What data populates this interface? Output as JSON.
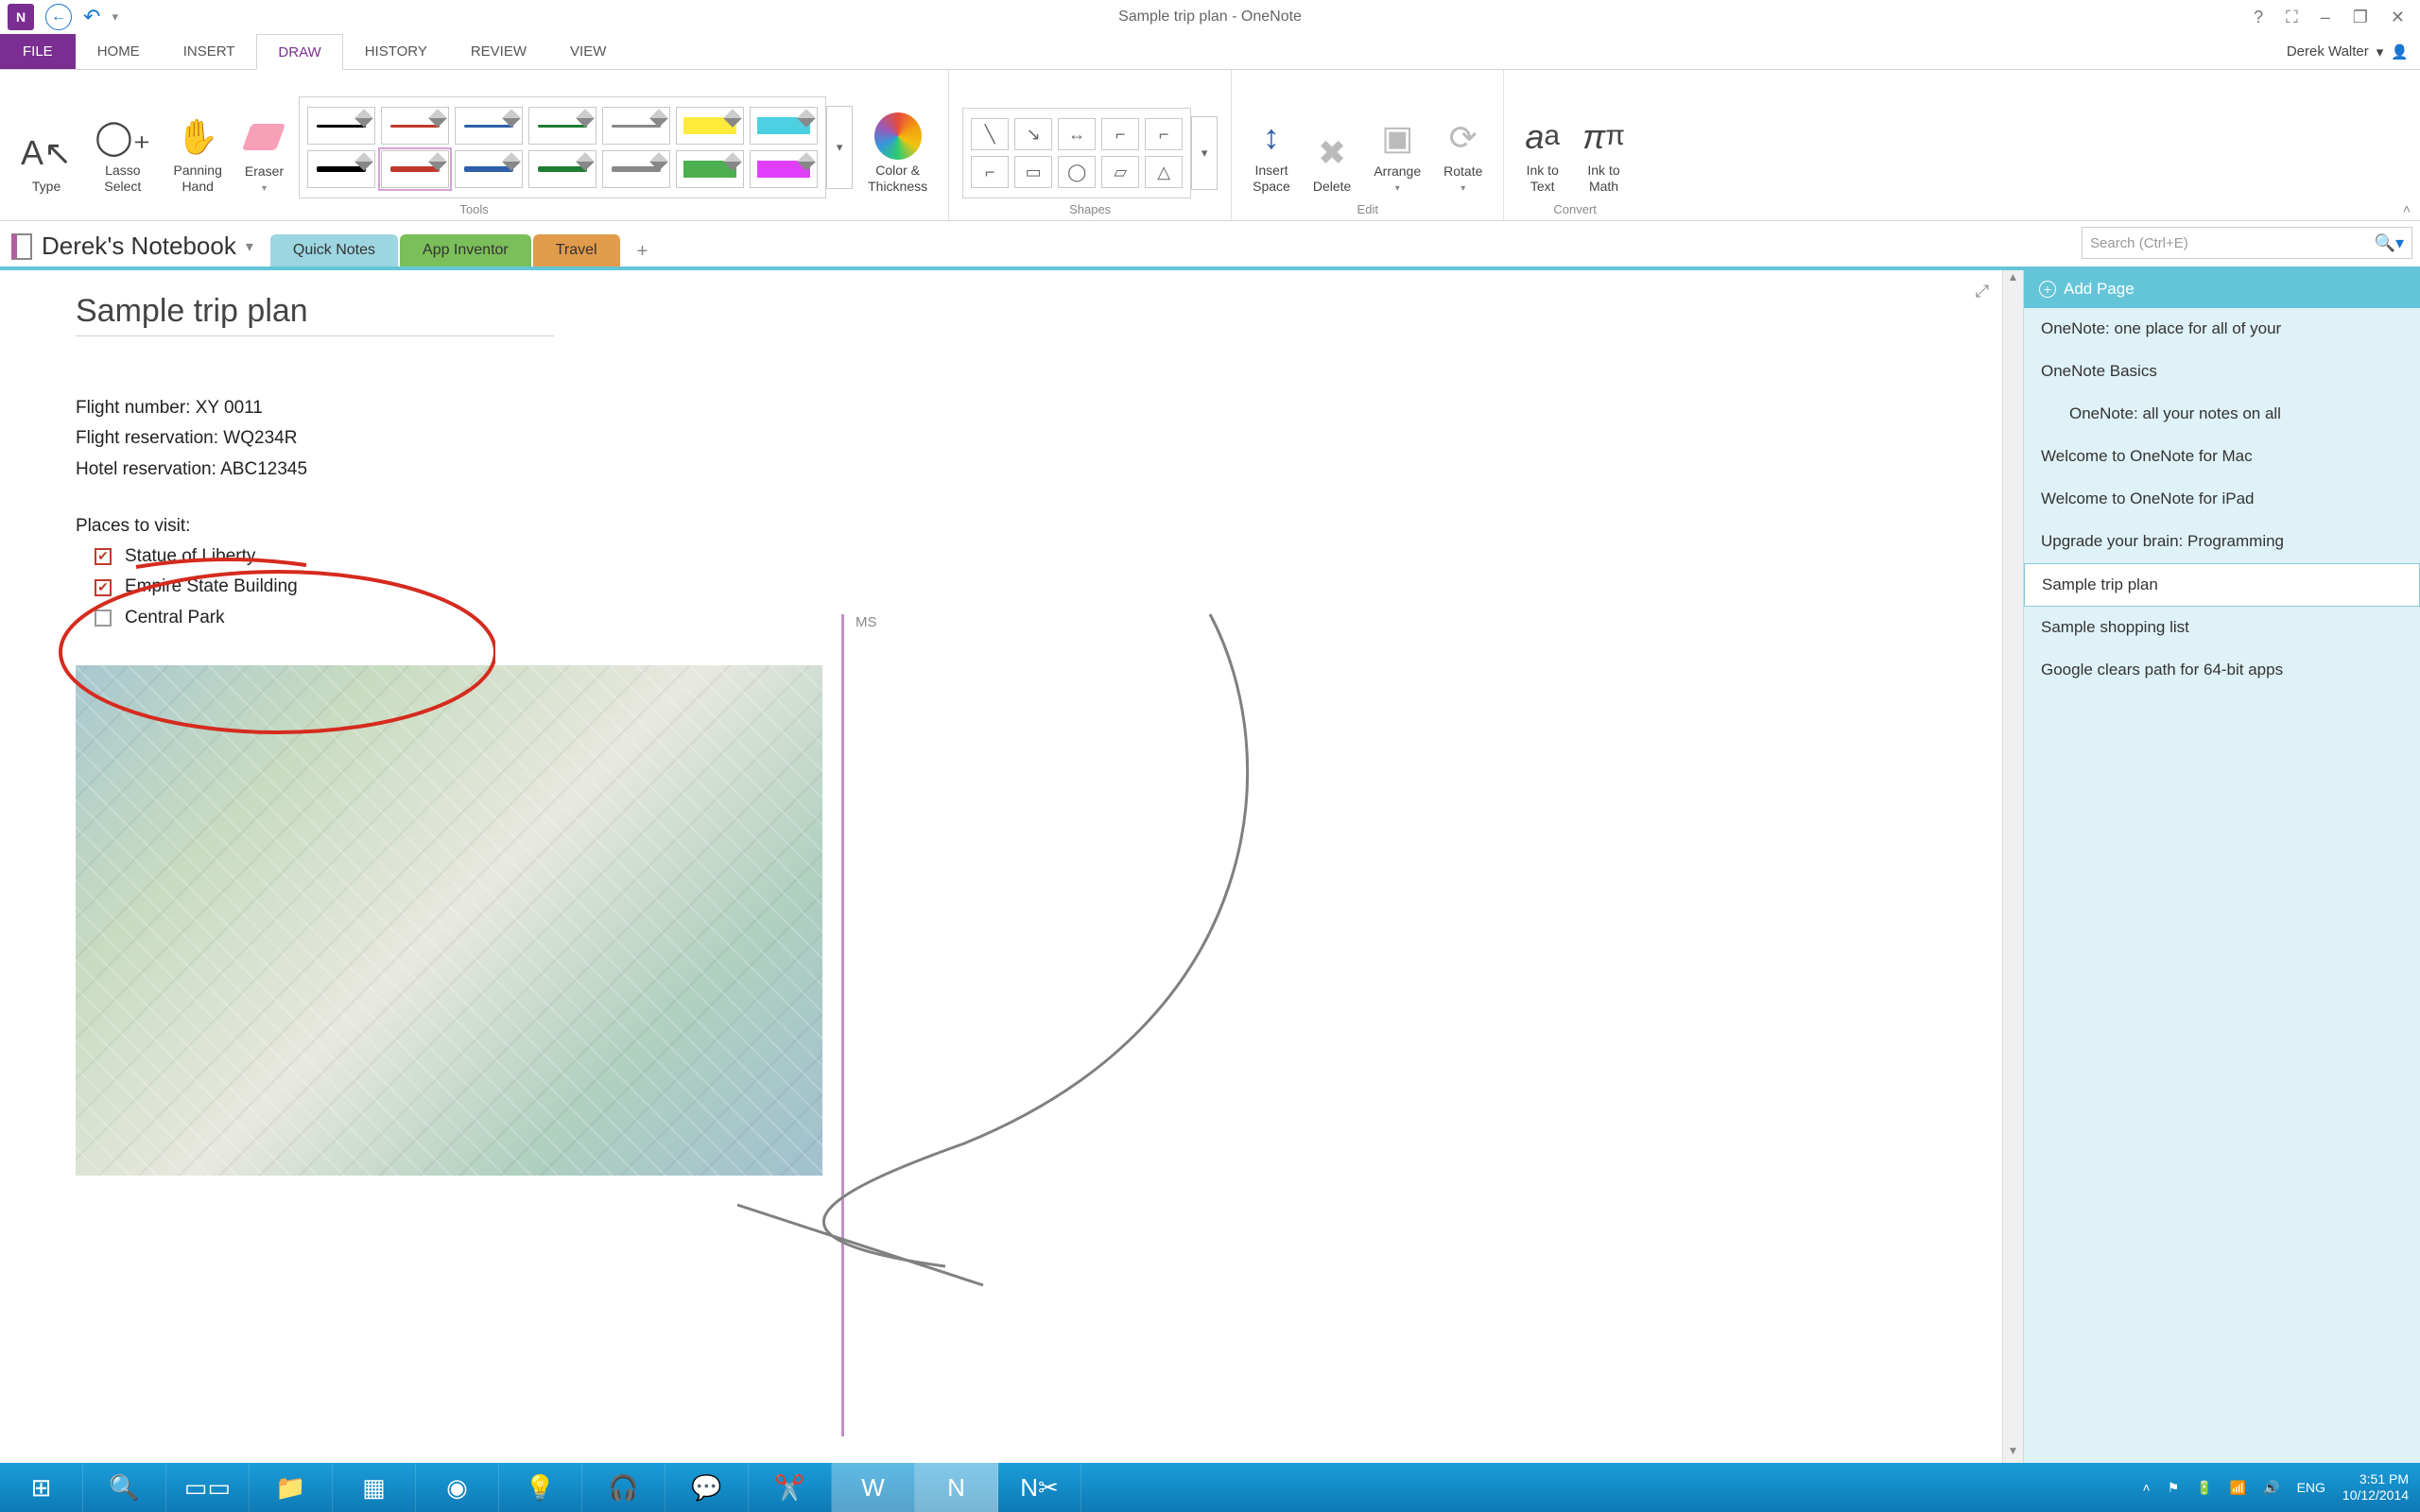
{
  "window": {
    "title": "Sample trip plan - OneNote",
    "controls": {
      "help": "?",
      "full": "⛶",
      "min": "–",
      "max": "❐",
      "close": "✕"
    }
  },
  "user_name": "Derek Walter",
  "ribbon_tabs": {
    "file": "FILE",
    "home": "HOME",
    "insert": "INSERT",
    "draw": "DRAW",
    "history": "HISTORY",
    "review": "REVIEW",
    "view": "VIEW"
  },
  "ribbon": {
    "type": "Type",
    "lasso": "Lasso\nSelect",
    "panning": "Panning\nHand",
    "eraser": "Eraser",
    "color_thickness": "Color &\nThickness",
    "insert_space": "Insert\nSpace",
    "delete": "Delete",
    "arrange": "Arrange",
    "rotate": "Rotate",
    "ink_to_text": "Ink to\nText",
    "ink_to_math": "Ink to\nMath",
    "groups": {
      "tools": "Tools",
      "shapes": "Shapes",
      "edit": "Edit",
      "convert": "Convert"
    }
  },
  "notebook": {
    "name": "Derek's Notebook",
    "sections": [
      "Quick Notes",
      "App Inventor",
      "Travel"
    ],
    "search_placeholder": "Search (Ctrl+E)"
  },
  "page": {
    "title": "Sample trip plan",
    "flight_number": "Flight number: XY 0011",
    "flight_reservation": "Flight reservation: WQ234R",
    "hotel_reservation": "Hotel reservation: ABC12345",
    "places_heading": "Places to visit:",
    "places": [
      {
        "label": "Statue of Liberty",
        "checked": true
      },
      {
        "label": "Empire State Building",
        "checked": true
      },
      {
        "label": "Central Park",
        "checked": false
      }
    ],
    "author_initials": "MS"
  },
  "page_list": {
    "add_page": "Add Page",
    "items": [
      "OneNote: one place for all of your",
      "OneNote Basics",
      "OneNote: all your notes on all",
      "Welcome to OneNote for Mac",
      "Welcome to OneNote for iPad",
      "Upgrade your brain: Programming",
      "Sample trip plan",
      "Sample shopping list",
      "Google clears path for 64-bit apps"
    ],
    "selected_index": 6,
    "indent_indices": [
      2
    ]
  },
  "taskbar": {
    "lang": "ENG",
    "time": "3:51 PM",
    "date": "10/12/2014"
  }
}
